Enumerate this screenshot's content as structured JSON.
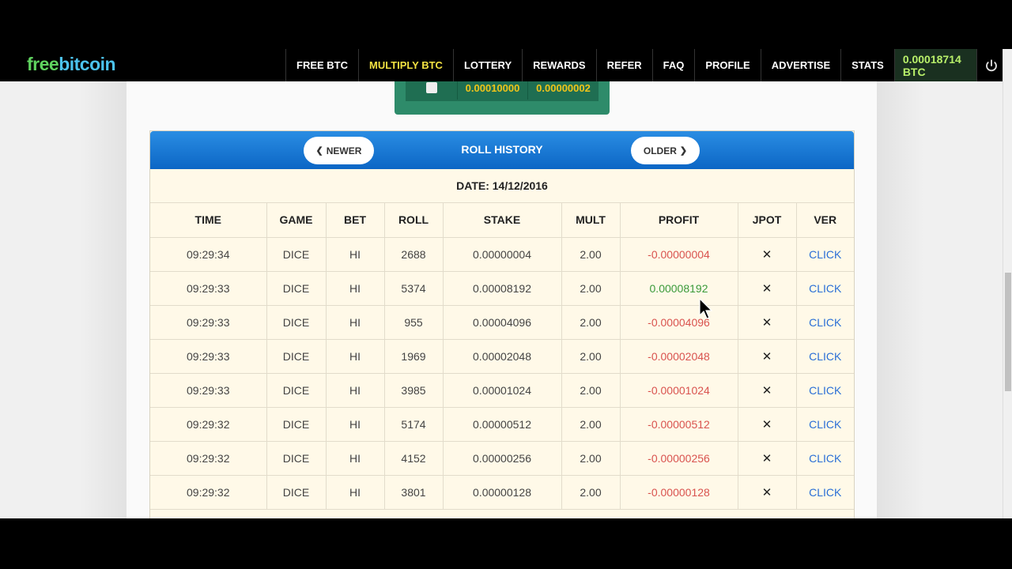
{
  "nav": {
    "logo_free": "free",
    "logo_bitcoin": "bitcoin",
    "items": [
      {
        "label": "FREE BTC",
        "active": false
      },
      {
        "label": "MULTIPLY BTC",
        "active": true
      },
      {
        "label": "LOTTERY",
        "active": false
      },
      {
        "label": "REWARDS",
        "active": false
      },
      {
        "label": "REFER",
        "active": false
      },
      {
        "label": "FAQ",
        "active": false
      },
      {
        "label": "PROFILE",
        "active": false
      },
      {
        "label": "ADVERTISE",
        "active": false
      },
      {
        "label": "STATS",
        "active": false
      }
    ],
    "balance": "0.00018714 BTC",
    "power_icon": "power-icon"
  },
  "bet_summary": {
    "value1": "0.00010000",
    "value2": "0.00000002"
  },
  "history": {
    "title": "ROLL HISTORY",
    "newer_label": "NEWER",
    "older_label": "OLDER",
    "date": "DATE: 14/12/2016",
    "columns": [
      "TIME",
      "GAME",
      "BET",
      "ROLL",
      "STAKE",
      "MULT",
      "PROFIT",
      "JPOT",
      "VER"
    ],
    "rows": [
      {
        "time": "09:29:34",
        "game": "DICE",
        "bet": "HI",
        "roll": "2688",
        "stake": "0.00000004",
        "mult": "2.00",
        "profit": "-0.00000004",
        "win": false,
        "jpot": "✕",
        "ver": "CLICK"
      },
      {
        "time": "09:29:33",
        "game": "DICE",
        "bet": "HI",
        "roll": "5374",
        "stake": "0.00008192",
        "mult": "2.00",
        "profit": "0.00008192",
        "win": true,
        "jpot": "✕",
        "ver": "CLICK"
      },
      {
        "time": "09:29:33",
        "game": "DICE",
        "bet": "HI",
        "roll": "955",
        "stake": "0.00004096",
        "mult": "2.00",
        "profit": "-0.00004096",
        "win": false,
        "jpot": "✕",
        "ver": "CLICK"
      },
      {
        "time": "09:29:33",
        "game": "DICE",
        "bet": "HI",
        "roll": "1969",
        "stake": "0.00002048",
        "mult": "2.00",
        "profit": "-0.00002048",
        "win": false,
        "jpot": "✕",
        "ver": "CLICK"
      },
      {
        "time": "09:29:33",
        "game": "DICE",
        "bet": "HI",
        "roll": "3985",
        "stake": "0.00001024",
        "mult": "2.00",
        "profit": "-0.00001024",
        "win": false,
        "jpot": "✕",
        "ver": "CLICK"
      },
      {
        "time": "09:29:32",
        "game": "DICE",
        "bet": "HI",
        "roll": "5174",
        "stake": "0.00000512",
        "mult": "2.00",
        "profit": "-0.00000512",
        "win": false,
        "jpot": "✕",
        "ver": "CLICK"
      },
      {
        "time": "09:29:32",
        "game": "DICE",
        "bet": "HI",
        "roll": "4152",
        "stake": "0.00000256",
        "mult": "2.00",
        "profit": "-0.00000256",
        "win": false,
        "jpot": "✕",
        "ver": "CLICK"
      },
      {
        "time": "09:29:32",
        "game": "DICE",
        "bet": "HI",
        "roll": "3801",
        "stake": "0.00000128",
        "mult": "2.00",
        "profit": "-0.00000128",
        "win": false,
        "jpot": "✕",
        "ver": "CLICK"
      }
    ]
  },
  "colors": {
    "header_blue": "#0c66c5",
    "loss_red": "#d9534f",
    "win_green": "#3a9a3a",
    "link_blue": "#2a6fd6",
    "active_nav_yellow": "#f4e242"
  }
}
